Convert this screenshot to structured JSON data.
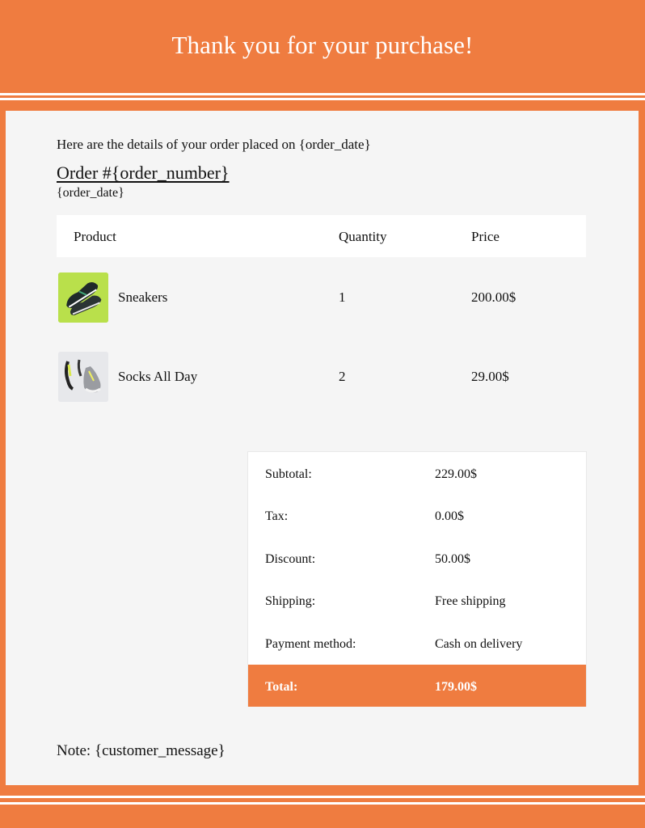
{
  "header": {
    "title": "Thank you for your purchase!"
  },
  "order": {
    "intro": "Here are the details of your order placed on {order_date}",
    "heading": "Order #{order_number}",
    "date": "{order_date}"
  },
  "items_table": {
    "columns": [
      "Product",
      "Quantity",
      "Price"
    ],
    "rows": [
      {
        "name": "Sneakers",
        "quantity": "1",
        "price": "200.00$",
        "icon": "sneakers-image"
      },
      {
        "name": "Socks All Day",
        "quantity": "2",
        "price": "29.00$",
        "icon": "socks-image"
      }
    ]
  },
  "totals": [
    {
      "label": "Subtotal:",
      "value": "229.00$"
    },
    {
      "label": "Tax:",
      "value": "0.00$"
    },
    {
      "label": "Discount:",
      "value": "50.00$"
    },
    {
      "label": "Shipping:",
      "value": "Free shipping"
    },
    {
      "label": "Payment method:",
      "value": "Cash on delivery"
    },
    {
      "label": "Total:",
      "value": "179.00$"
    }
  ],
  "note": "Note: {customer_message}",
  "colors": {
    "accent": "#ef7c40",
    "panel": "#f5f5f5",
    "white": "#ffffff"
  }
}
